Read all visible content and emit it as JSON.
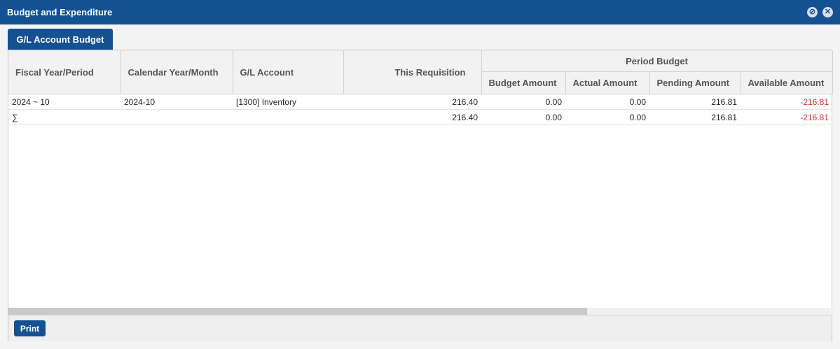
{
  "window": {
    "title": "Budget and Expenditure",
    "minimize_icon": "⊘",
    "close_icon": "✕"
  },
  "tabs": [
    {
      "label": "G/L Account Budget",
      "active": true
    }
  ],
  "table": {
    "columns": {
      "fiscal": "Fiscal Year/Period",
      "calendar": "Calendar Year/Month",
      "account": "G/L Account",
      "requisition": "This Requisition",
      "period_group": "Period Budget",
      "budget": "Budget Amount",
      "actual": "Actual Amount",
      "pending": "Pending Amount",
      "available": "Available Amount"
    },
    "rows": [
      {
        "fiscal": "2024 ~ 10",
        "calendar": "2024-10",
        "account": "[1300] Inventory",
        "requisition": "216.40",
        "budget": "0.00",
        "actual": "0.00",
        "pending": "216.81",
        "available": "-216.81"
      },
      {
        "fiscal": "∑",
        "calendar": "",
        "account": "",
        "requisition": "216.40",
        "budget": "0.00",
        "actual": "0.00",
        "pending": "216.81",
        "available": "-216.81"
      }
    ]
  },
  "footer": {
    "print_label": "Print"
  },
  "colors": {
    "primary": "#145192",
    "negative": "#d32f2f"
  }
}
